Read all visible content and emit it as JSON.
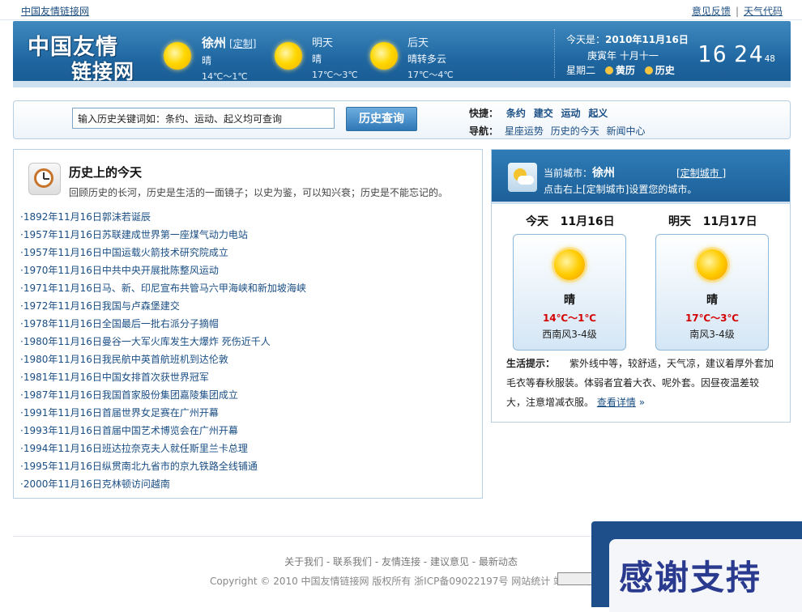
{
  "topbar": {
    "site_link": "中国友情链接网",
    "feedback": "意见反馈",
    "separator": "|",
    "weather_code": "天气代码"
  },
  "header": {
    "logo_line1": "中国友情",
    "logo_line2": "链接网",
    "weather": [
      {
        "city": "徐州",
        "customize": "[定制]",
        "cond": "晴",
        "temp": "14℃～1℃"
      },
      {
        "day": "明天",
        "cond": "晴",
        "temp": "17℃～3℃"
      },
      {
        "day": "后天",
        "cond": "晴转多云",
        "temp": "17℃～4℃"
      }
    ],
    "date": {
      "label": "今天是：",
      "value": "2010年11月16日",
      "lunar": "庚寅年  十月十一",
      "weekday": "星期二",
      "huangli": "黄历",
      "history": "历史"
    },
    "clock": {
      "hours": "16",
      "minutes": "24",
      "seconds": "48"
    }
  },
  "search": {
    "value": "输入历史关键词如：条约、运动、起义均可查询",
    "button": "历史查询",
    "quick_label": "快捷：",
    "quick_links": [
      "条约",
      "建交",
      "运动",
      "起义"
    ],
    "nav_label": "导航：",
    "nav_links": [
      "星座运势",
      "历史的今天",
      "新闻中心"
    ]
  },
  "history": {
    "title": "历史上的今天",
    "subtitle": "回顾历史的长河，历史是生活的一面镜子；以史为鉴，可以知兴衰；历史是不能忘记的。",
    "events": [
      "·1892年11月16日郭沫若诞辰",
      "·1957年11月16日苏联建成世界第一座煤气动力电站",
      "·1957年11月16日中国运载火箭技术研究院成立",
      "·1970年11月16日中共中央开展批陈整风运动",
      "·1971年11月16日马、新、印尼宣布共管马六甲海峡和新加坡海峡",
      "·1972年11月16日我国与卢森堡建交",
      "·1978年11月16日全国最后一批右派分子摘帽",
      "·1980年11月16日曼谷一大军火库发生大爆炸  死伤近千人",
      "·1980年11月16日我民航中英首航班机到达伦敦",
      "·1981年11月16日中国女排首次获世界冠军",
      "·1987年11月16日我国首家股份集团嘉陵集团成立",
      "·1991年11月16日首届世界女足赛在广州开幕",
      "·1993年11月16日首届中国艺术博览会在广州开幕",
      "·1994年11月16日班达拉奈克夫人就任斯里兰卡总理",
      "·1995年11月16日纵贯南北九省市的京九铁路全线铺通",
      "·2000年11月16日克林顿访问越南"
    ]
  },
  "city_weather": {
    "current_label": "当前城市：",
    "city": "徐州",
    "customize": "[定制城市 ]",
    "hint": "点击右上[定制城市]设置您的城市。",
    "days": [
      {
        "label": "今天",
        "date": "11月16日",
        "cond": "晴",
        "temp": "14℃～1℃",
        "wind": "西南风3-4级"
      },
      {
        "label": "明天",
        "date": "11月17日",
        "cond": "晴",
        "temp": "17℃～3℃",
        "wind": "南风3-4级"
      }
    ],
    "tip_label": "生活提示：",
    "tip_text": "紫外线中等，较舒适，天气凉，建议着厚外套加毛衣等春秋服装。体弱者宜着大衣、呢外套。因昼夜温差较大，注意增减衣服。",
    "more": "查看详情",
    "more_arrow": "»"
  },
  "footer": {
    "links": "关于我们 - 联系我们 - 友情连接 - 建议意见 - 最新动态",
    "copyright": "Copyright © 2010 中国友情链接网 版权所有  浙ICP备09022197号  网站统计 站长统计"
  },
  "popup": {
    "text": "感谢支持"
  }
}
